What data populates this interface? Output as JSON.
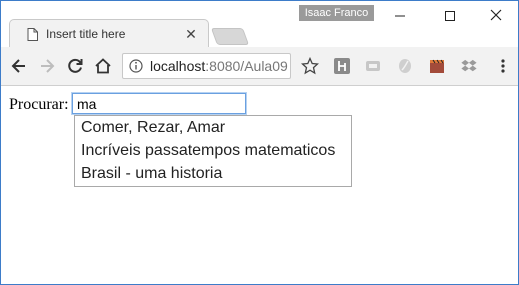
{
  "window": {
    "user_name": "Isaac Franco",
    "tab_title": "Insert title here"
  },
  "toolbar": {
    "url_host": "localhost",
    "url_rest": ":8080/Aula09"
  },
  "page": {
    "search_label": "Procurar:",
    "search_value": "ma",
    "suggestions": [
      "Comer, Rezar, Amar",
      "Incríveis passatempos matematicos",
      "Brasil - uma historia"
    ]
  },
  "colors": {
    "accent_border": "#3d7cc9",
    "focus_ring": "#6aa0e0"
  }
}
